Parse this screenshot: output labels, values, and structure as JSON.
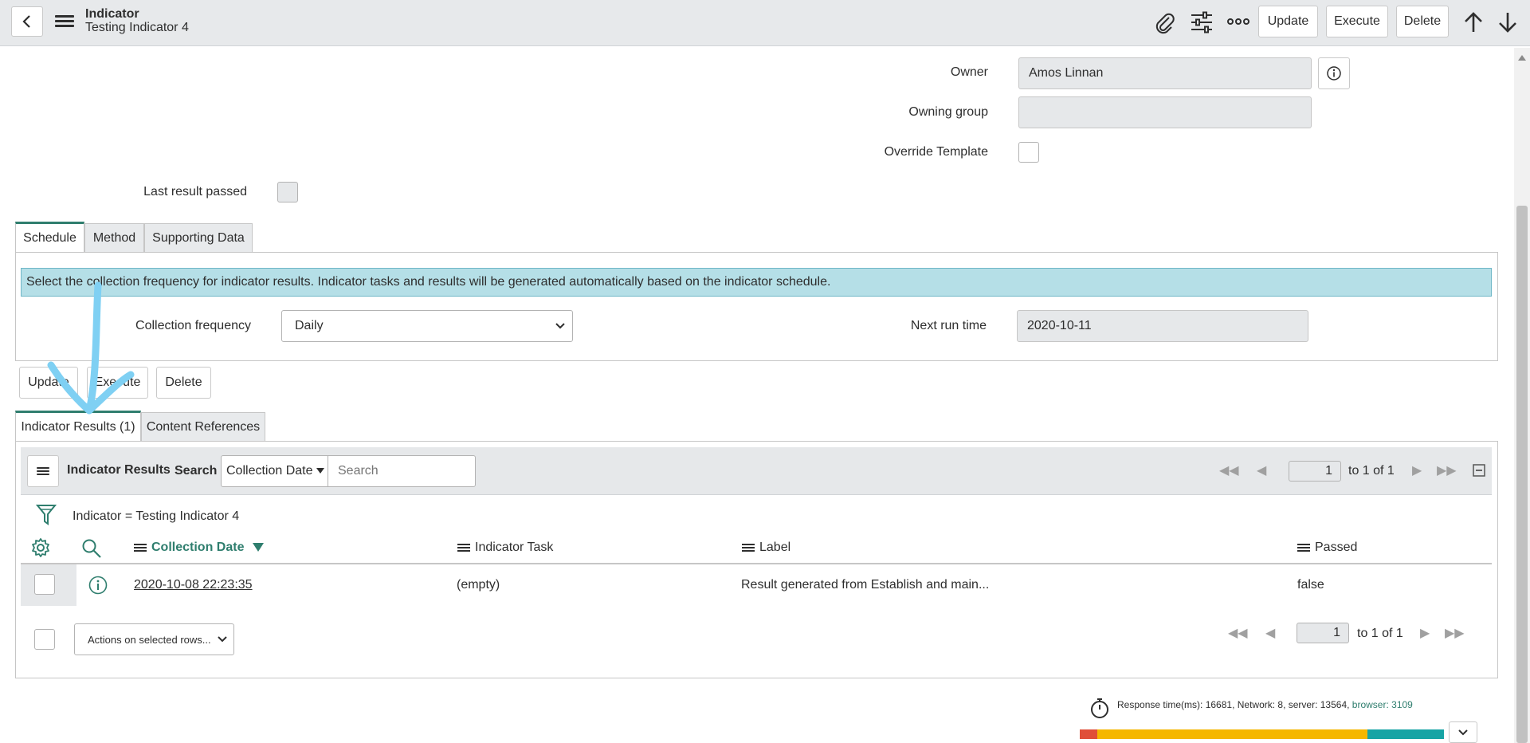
{
  "header": {
    "record_type": "Indicator",
    "record_name": "Testing Indicator 4",
    "buttons": {
      "update": "Update",
      "execute": "Execute",
      "delete": "Delete"
    }
  },
  "form": {
    "owner_label": "Owner",
    "owner_value": "Amos Linnan",
    "owning_group_label": "Owning group",
    "owning_group_value": "",
    "override_template_label": "Override Template",
    "last_result_passed_label": "Last result passed"
  },
  "tabs_top": [
    "Schedule",
    "Method",
    "Supporting Data"
  ],
  "schedule": {
    "info_message": "Select the collection frequency for indicator results. Indicator tasks and results will be generated automatically based on the indicator schedule.",
    "collection_frequency_label": "Collection frequency",
    "collection_frequency_value": "Daily",
    "next_run_time_label": "Next run time",
    "next_run_time_value": "2020-10-11"
  },
  "form_buttons": {
    "update": "Update",
    "execute": "Execute",
    "delete": "Delete"
  },
  "tabs_related": [
    "Indicator Results (1)",
    "Content References"
  ],
  "list": {
    "title": "Indicator Results",
    "search_label": "Search",
    "search_field": "Collection Date",
    "search_placeholder": "Search",
    "page_value": "1",
    "page_total": "to 1 of 1",
    "filter_text": "Indicator = Testing Indicator 4",
    "columns": [
      "Collection Date",
      "Indicator Task",
      "Label",
      "Passed"
    ],
    "rows": [
      {
        "collection_date": "2020-10-08 22:23:35",
        "indicator_task": "(empty)",
        "label": "Result generated from Establish and main...",
        "passed": "false"
      }
    ],
    "actions_placeholder": "Actions on selected rows...",
    "footer_page_value": "1",
    "footer_page_total": "to 1 of 1"
  },
  "response": {
    "text": "Response time(ms): 16681, Network: 8, server: 13564, ",
    "browser": "browser: 3109"
  },
  "colors": {
    "accent": "#2f7e6e",
    "info_bg": "#b5dfe7",
    "bar_red": "#e04f39",
    "bar_yellow": "#f5b700",
    "bar_teal": "#17a4a5",
    "annotation": "#7fd0f3"
  }
}
